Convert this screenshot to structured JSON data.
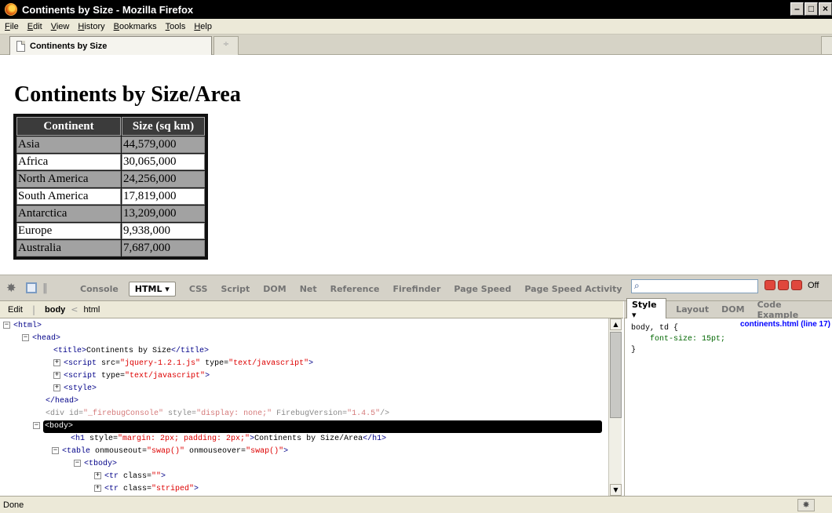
{
  "window": {
    "title": "Continents by Size - Mozilla Firefox",
    "min_glyph": "–",
    "max_glyph": "□",
    "close_glyph": "×"
  },
  "menu": [
    "File",
    "Edit",
    "View",
    "History",
    "Bookmarks",
    "Tools",
    "Help"
  ],
  "tabs": {
    "active_label": "Continents by Size",
    "new_tab_glyph": "÷"
  },
  "page": {
    "heading": "Continents by Size/Area",
    "table": {
      "headers": [
        "Continent",
        "Size (sq km)"
      ],
      "rows": [
        {
          "continent": "Asia",
          "size": "44,579,000",
          "striped": true
        },
        {
          "continent": "Africa",
          "size": "30,065,000",
          "striped": false
        },
        {
          "continent": "North America",
          "size": "24,256,000",
          "striped": true
        },
        {
          "continent": "South America",
          "size": "17,819,000",
          "striped": false
        },
        {
          "continent": "Antarctica",
          "size": "13,209,000",
          "striped": true
        },
        {
          "continent": "Europe",
          "size": "9,938,000",
          "striped": false
        },
        {
          "continent": "Australia",
          "size": "7,687,000",
          "striped": true
        }
      ]
    }
  },
  "firebug": {
    "tabs": [
      "Console",
      "HTML ▾",
      "CSS",
      "Script",
      "DOM",
      "Net",
      "Reference",
      "Firefinder",
      "Page Speed",
      "Page Speed Activity"
    ],
    "active_tab": 1,
    "search_placeholder": "",
    "off_label": "Off",
    "subbar": {
      "edit": "Edit",
      "crumb_active": "body",
      "crumb_sep": "<",
      "crumb_parent": "html"
    },
    "side_tabs": [
      "Style ▾",
      "Layout",
      "DOM",
      "Code Example"
    ],
    "style_source": "continents.html (line 17)",
    "style_rule": {
      "selector": "body, td {",
      "property": "font-size",
      "value": "15pt;",
      "close": "}"
    }
  },
  "status": {
    "text": "Done"
  }
}
